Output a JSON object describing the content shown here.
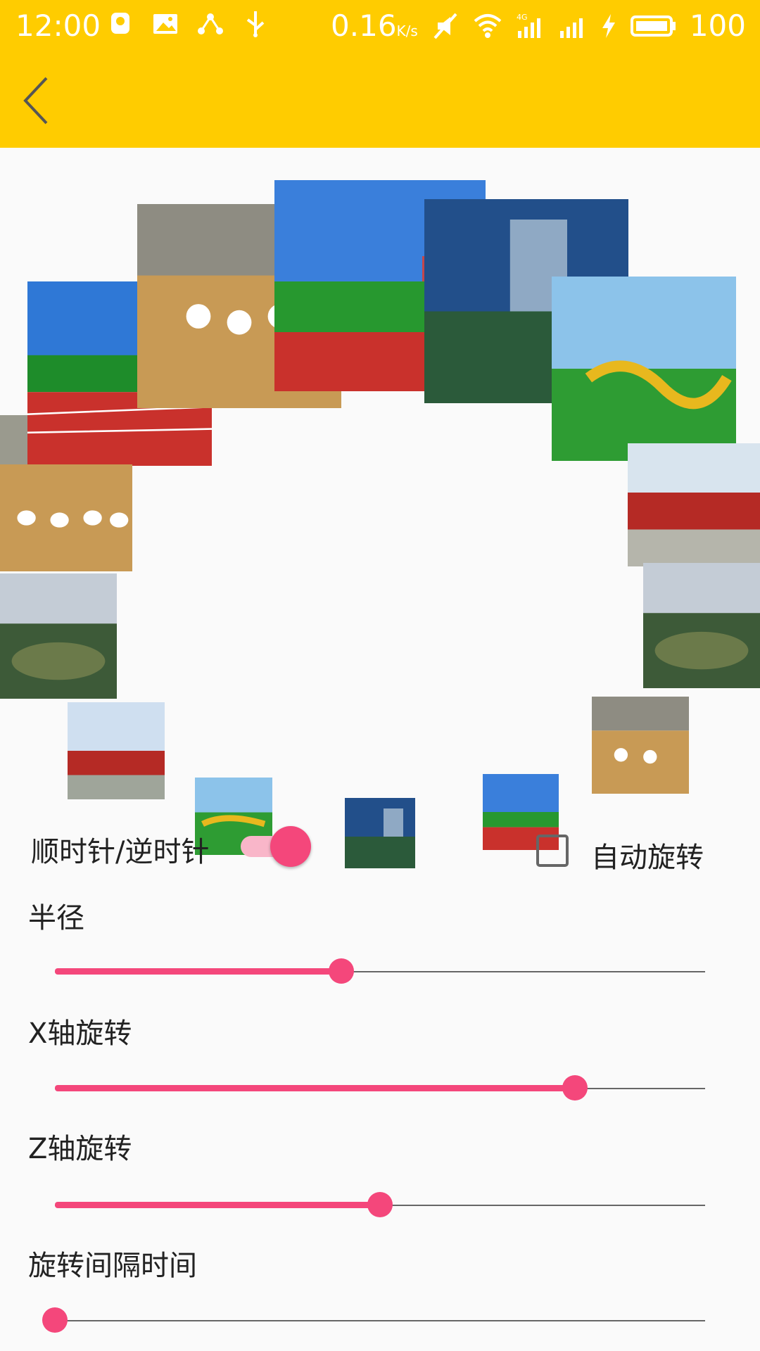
{
  "status_bar": {
    "time": "12:00",
    "left_icons": [
      "notification-icon",
      "image-icon",
      "share-icon",
      "usb-icon"
    ],
    "speed": "0.16",
    "speed_unit": "K/s",
    "network": "4G",
    "battery": "100"
  },
  "toolbar": {
    "back_icon": "chevron-left-icon"
  },
  "carousel": {
    "photos": [
      "track",
      "gym-crowd",
      "stadium",
      "dragon",
      "banner",
      "campus",
      "track",
      "gym-crowd",
      "banner",
      "campus",
      "stadium",
      "track"
    ]
  },
  "controls": {
    "direction_label": "顺时针/逆时针",
    "direction_switch_on": true,
    "auto_rotate_label": "自动旋转",
    "auto_rotate_checked": false,
    "radius_label": "半径",
    "radius_value": 0.44,
    "x_rotation_label": "X轴旋转",
    "x_rotation_value": 0.8,
    "z_rotation_label": "Z轴旋转",
    "z_rotation_value": 0.5,
    "interval_label": "旋转间隔时间",
    "interval_value": 0.0
  },
  "colors": {
    "accent": "#FFCC00",
    "slider": "#f4477b",
    "background": "#fafafa"
  }
}
